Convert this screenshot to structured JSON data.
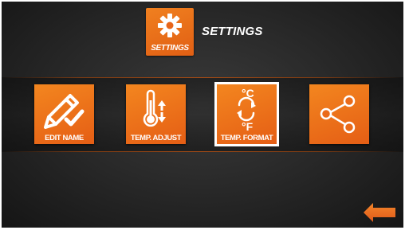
{
  "header": {
    "icon_label": "SETTINGS",
    "title": "SETTINGS"
  },
  "tiles": [
    {
      "label": "EDIT NAME",
      "icon": "pencil-check-icon",
      "selected": false
    },
    {
      "label": "TEMP. ADJUST",
      "icon": "thermometer-arrows-icon",
      "selected": false
    },
    {
      "label": "TEMP. FORMAT",
      "icon": "celsius-fahrenheit-icon",
      "selected": true,
      "celsius": "°C",
      "fahrenheit": "°F"
    },
    {
      "label": "",
      "icon": "share-icon",
      "selected": false
    }
  ],
  "footer": {
    "back_icon": "back-arrow-icon"
  },
  "colors": {
    "accent": "#e8661a",
    "background": "#2a2a2a",
    "text": "#ffffff"
  }
}
